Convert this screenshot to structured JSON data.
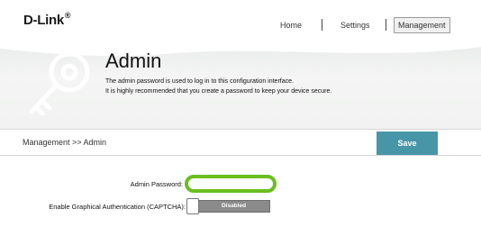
{
  "brand": {
    "logo_text": "D-Link",
    "logo_mark": "®"
  },
  "nav": {
    "items": [
      "Home",
      "Settings",
      "Management"
    ],
    "active": "Management"
  },
  "banner": {
    "title": "Admin",
    "desc_line1": "The admin password is used to log in to this configuration interface.",
    "desc_line2": "It is highly recommended that you create a password to keep your device secure.",
    "icon": "key-icon"
  },
  "breadcrumb": "Management >> Admin",
  "actions": {
    "save_label": "Save",
    "accent": "#4796a8"
  },
  "form": {
    "password_label": "Admin Password:",
    "password_value": "",
    "captcha_label": "Enable Graphical Authentication (CAPTCHA):",
    "captcha_state": "Disabled",
    "highlight_color": "#6abf1f"
  }
}
